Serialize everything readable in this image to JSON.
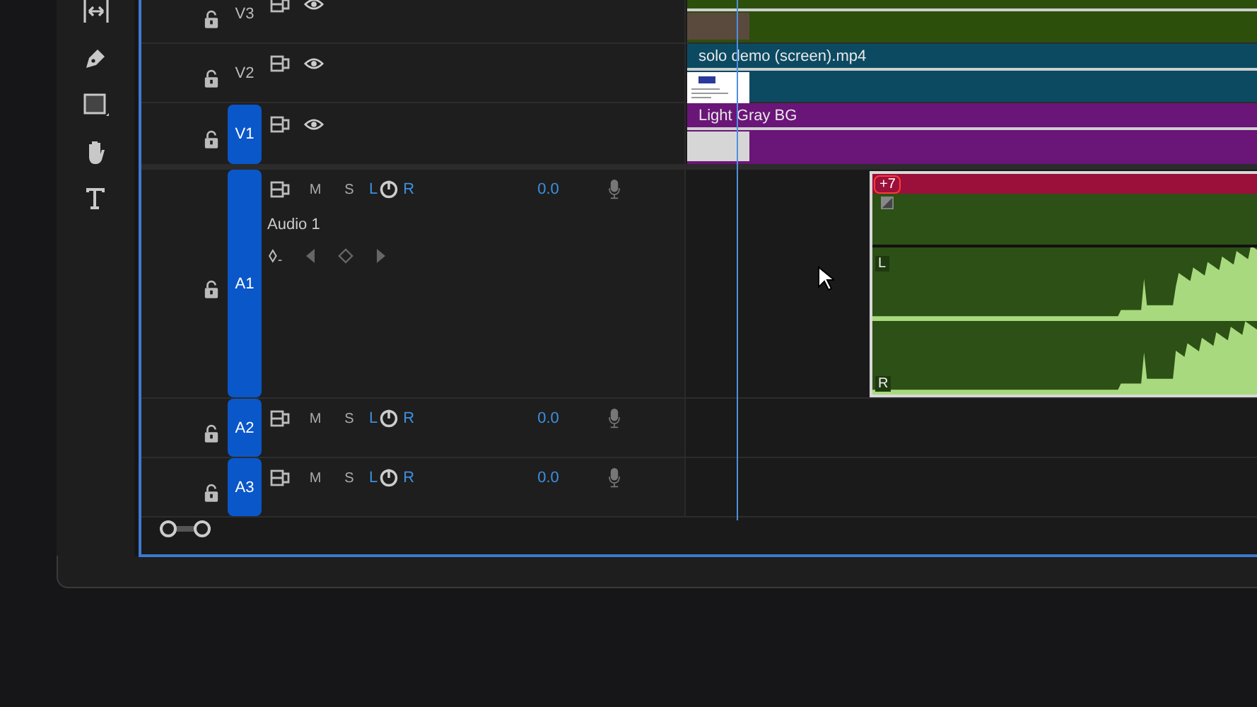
{
  "video_tracks": [
    {
      "label": "V3",
      "targeted": false,
      "clip": {
        "color": "#2d4f0c",
        "kind": "photo"
      }
    },
    {
      "label": "V2",
      "targeted": false,
      "clip": {
        "title": "solo demo (screen).mp4",
        "color": "#0c4a62",
        "kind": "screen"
      }
    },
    {
      "label": "V1",
      "targeted": true,
      "clip": {
        "title": "Light Gray BG",
        "color": "#6a1578",
        "kind": "plain"
      }
    }
  ],
  "audio_tracks": [
    {
      "label": "A1",
      "targeted": true,
      "expanded": true,
      "name": "Audio 1",
      "mute": "M",
      "solo": "S",
      "pan_left": "L",
      "pan_right": "R",
      "volume": "0.0",
      "clip": {
        "badge": "+7",
        "channels": [
          "L",
          "R"
        ]
      }
    },
    {
      "label": "A2",
      "targeted": true,
      "expanded": false,
      "mute": "M",
      "solo": "S",
      "pan_left": "L",
      "pan_right": "R",
      "volume": "0.0"
    },
    {
      "label": "A3",
      "targeted": true,
      "expanded": false,
      "mute": "M",
      "solo": "S",
      "pan_left": "L",
      "pan_right": "R",
      "volume": "0.0"
    }
  ]
}
